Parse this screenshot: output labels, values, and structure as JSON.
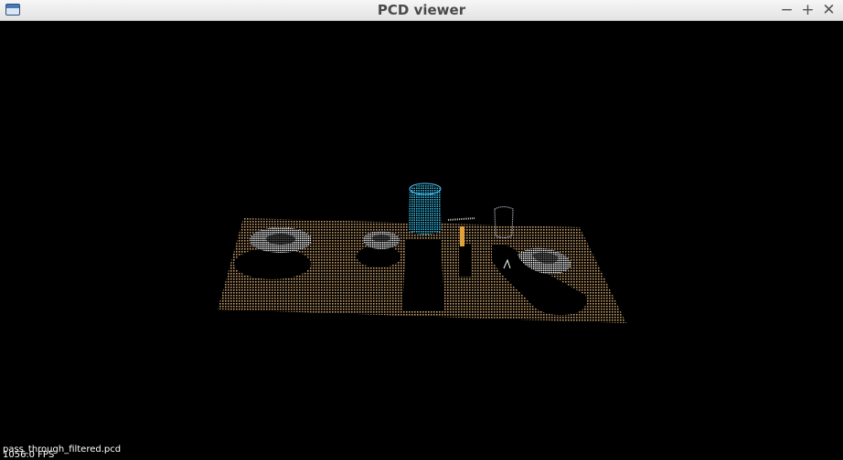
{
  "window": {
    "title": "PCD viewer",
    "icon": "app-window-icon",
    "controls": {
      "minimize": "−",
      "maximize": "+",
      "close": "✕"
    }
  },
  "viewer": {
    "background": "#000000",
    "fps_text": "1056.0 FPS",
    "filename": "pass_through_filtered.pcd",
    "colors": {
      "table": "#c9a06a",
      "cup": "#2fb7e6",
      "objects": "#ffffff",
      "tube": "#e6a13a"
    }
  }
}
